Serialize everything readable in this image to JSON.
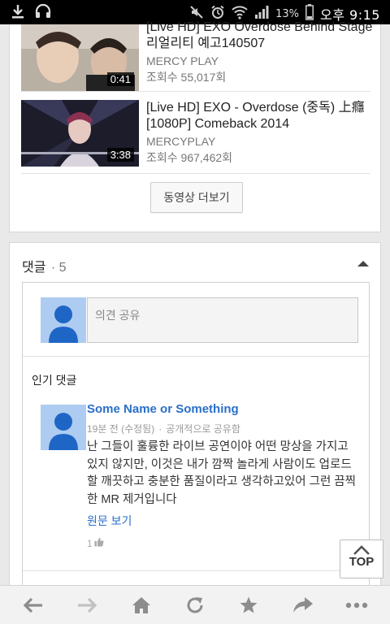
{
  "status_bar": {
    "battery": "13%",
    "clock": "오후 9:15"
  },
  "videos": [
    {
      "title": "[Live HD] EXO Overdose Behind Stage 리얼리티 예고140507",
      "channel": "MERCY PLAY",
      "views": "조회수 55,017회",
      "duration": "0:41"
    },
    {
      "title": "[Live HD] EXO - Overdose (중독) 上癮 [1080P] Comeback 2014",
      "channel": "MERCYPLAY",
      "views": "조회수 967,462회",
      "duration": "3:38"
    }
  ],
  "more_videos_label": "동영상 더보기",
  "comments": {
    "header": "댓글",
    "count": "· 5",
    "share_placeholder": "의견 공유",
    "popular_label": "인기 댓글",
    "items": [
      {
        "author": "Some Name or Something",
        "time": "19분 전 (수정됨)",
        "visibility": "공개적으로 공유함",
        "text": "난 그들이 훌륭한 라이브 공연이야 어떤 망상을 가지고 있지 않지만, 이것은 내가 깜짝 놀라게 사람이도 업로드 할 깨끗하고 충분한 품질이라고 생각하고있어 그런 끔찍한 MR 제거입니다",
        "link": "원문 보기",
        "likes": "1"
      }
    ]
  },
  "top_button_label": "TOP",
  "colors": {
    "link_blue": "#2a6fc9",
    "avatar_bg": "#aecbf1",
    "avatar_fg": "#1e66c6"
  }
}
